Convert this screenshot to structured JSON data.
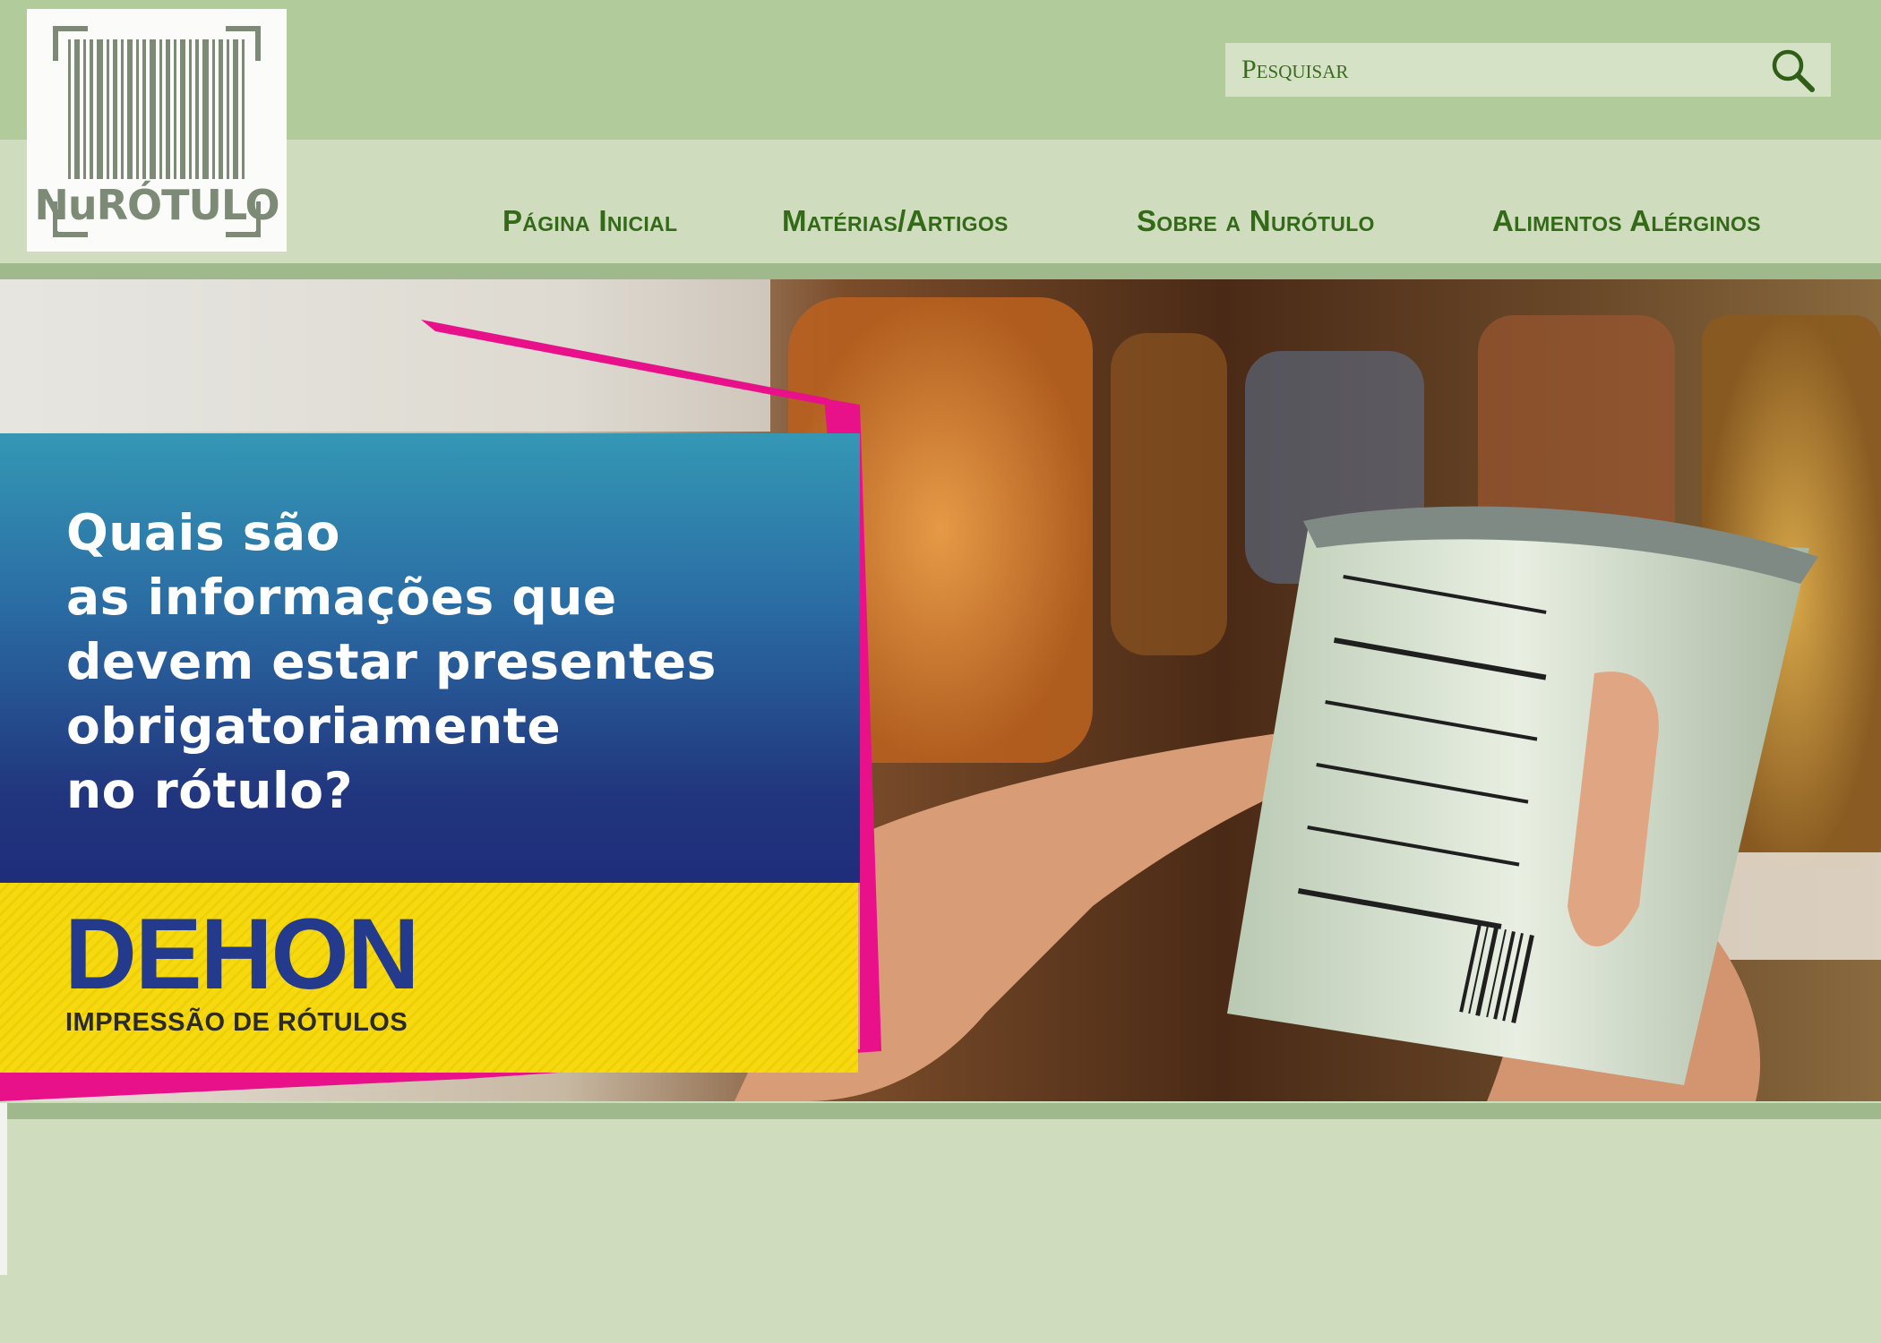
{
  "logo": {
    "text": "NuRÓTULO",
    "icon": "barcode-icon"
  },
  "search": {
    "placeholder": "Pesquisar",
    "value": "",
    "icon": "search-icon"
  },
  "nav": {
    "items": [
      {
        "label": "Página Inicial"
      },
      {
        "label": "Matérias/Artigos"
      },
      {
        "label": "Sobre a Nurótulo"
      },
      {
        "label": "Alimentos Alérginos"
      }
    ]
  },
  "hero": {
    "heading_lines": [
      "Quais são",
      "as informações que",
      "devem estar presentes",
      "obrigatoriamente",
      "no rótulo?"
    ],
    "brand": "DEHON",
    "tagline": "IMPRESSÃO DE RÓTULOS"
  },
  "colors": {
    "header_top": "#b1cb9a",
    "header_nav": "#cfdcbe",
    "nav_text": "#336a18",
    "accent_pink": "#e8118a",
    "panel_blue": "#21367e",
    "panel_yellow": "#f6d90f"
  }
}
